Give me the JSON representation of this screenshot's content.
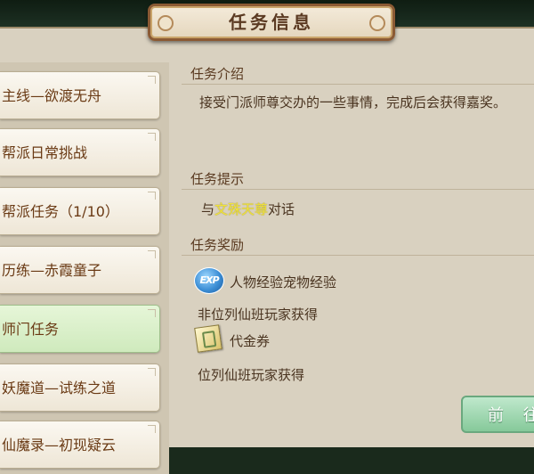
{
  "title": "任务信息",
  "tabs": [
    {
      "label": "主线—欲渡无舟",
      "active": false
    },
    {
      "label": "帮派日常挑战",
      "active": false
    },
    {
      "label": "帮派任务（1/10）",
      "active": false
    },
    {
      "label": "历练—赤霞童子",
      "active": false
    },
    {
      "label": "师门任务",
      "active": true
    },
    {
      "label": "妖魔道—试练之道",
      "active": false
    },
    {
      "label": "仙魔录—初现疑云",
      "active": false
    }
  ],
  "intro": {
    "heading": "任务介绍",
    "text": "接受门派师尊交办的一些事情，完成后会获得嘉奖。"
  },
  "hint": {
    "heading": "任务提示",
    "prefix": "与",
    "npc": "文殊天尊",
    "suffix": "对话"
  },
  "rewards": {
    "heading": "任务奖励",
    "items": [
      {
        "icon": "exp-icon",
        "icon_text": "EXP",
        "label": "人物经验宠物经验",
        "note": "非位列仙班玩家获得"
      },
      {
        "icon": "voucher-icon",
        "label": "代金券",
        "note": "位列仙班玩家获得"
      }
    ]
  },
  "go_button": "前 往",
  "colors": {
    "panel": "#d9d1c0",
    "active_tab": "#cfeabd",
    "highlight": "#f2e43c",
    "button": "#86c99a"
  }
}
